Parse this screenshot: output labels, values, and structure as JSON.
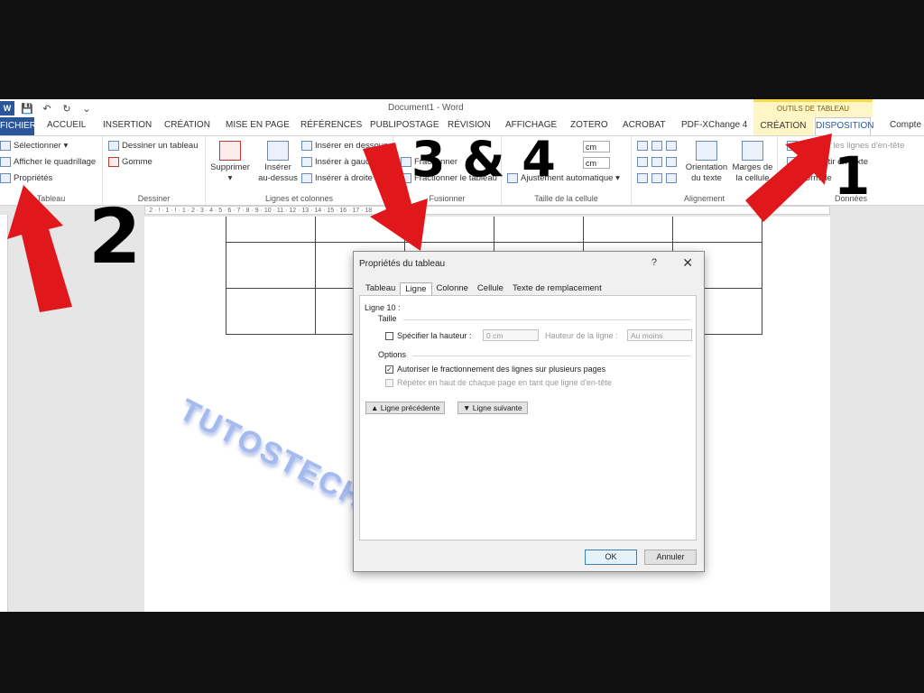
{
  "window": {
    "title": "Document1 - Word",
    "context_header": "OUTILS DE TABLEAU"
  },
  "quick_access": {
    "word_logo": "W",
    "save": "💾",
    "undo": "↶",
    "redo": "↻",
    "more": "⌄"
  },
  "tabs": {
    "file": "FICHIER",
    "items": [
      "ACCUEIL",
      "INSERTION",
      "CRÉATION",
      "MISE EN PAGE",
      "RÉFÉRENCES",
      "PUBLIPOSTAGE",
      "RÉVISION",
      "AFFICHAGE",
      "ZOTERO",
      "ACROBAT",
      "PDF-XChange 4"
    ],
    "ctx_creation": "CRÉATION",
    "ctx_disposition": "DISPOSITION",
    "account": "Compte"
  },
  "ribbon": {
    "tableau": {
      "select": "Sélectionner ▾",
      "grid": "Afficher le quadrillage",
      "props": "Propriétés",
      "label": "Tableau"
    },
    "dessiner": {
      "draw": "Dessiner un tableau",
      "eraser": "Gomme",
      "label": "Dessiner"
    },
    "lignes": {
      "delete": "Supprimer",
      "delete_arrow": "▾",
      "insert_above_1": "Insérer",
      "insert_above_2": "au-dessus",
      "insert_below": "Insérer en dessous",
      "insert_left": "Insérer à gauche",
      "insert_right": "Insérer à droite",
      "label": "Lignes et colonnes"
    },
    "fusionner": {
      "merge": "Fractionner",
      "split_table": "Fractionner le tableau",
      "label": "Fusionner"
    },
    "taille": {
      "height": "cm",
      "width": "cm",
      "autofit": "Ajustement automatique ▾",
      "label": "Taille de la cellule"
    },
    "alignement": {
      "orientation_1": "Orientation",
      "orientation_2": "du texte",
      "margins_1": "Marges de",
      "margins_2": "la cellule",
      "label": "Alignement"
    },
    "donnees": {
      "repeat": "Répéter les lignes d'en-tête",
      "convert": "Convertir en texte",
      "formula": "Formule",
      "label": "Données"
    }
  },
  "ruler": "· 2 · ! · 1 · ! · 1 · 2 · 3 · 4 · 5 · 6 · 7 · 8 · 9 · 10 · 11 · 12 · 13 · 14 · 15 · 16 · 17 · 18",
  "watermark": "TUTOSTECH.COM",
  "dialog": {
    "title": "Propriétés du tableau",
    "help": "?",
    "close": "✕",
    "tabs": [
      "Tableau",
      "Ligne",
      "Colonne",
      "Cellule",
      "Texte de remplacement"
    ],
    "row_label": "Ligne 10 :",
    "size_label": "Taille",
    "specify_height": "Spécifier la hauteur :",
    "height_value": "0 cm",
    "row_height_label": "Hauteur de la ligne :",
    "row_height_value": "Au moins",
    "options_label": "Options",
    "allow_break": "Autoriser le fractionnement des lignes sur plusieurs pages",
    "repeat_header": "Répéter en haut de chaque page en tant que ligne d'en-tête",
    "prev_row": "Ligne précédente",
    "next_row": "Ligne suivante",
    "ok": "OK",
    "cancel": "Annuler"
  },
  "annotations": {
    "num1": "1",
    "num2": "2",
    "num34": "3 & 4",
    "arrow_color": "#e0181b"
  }
}
